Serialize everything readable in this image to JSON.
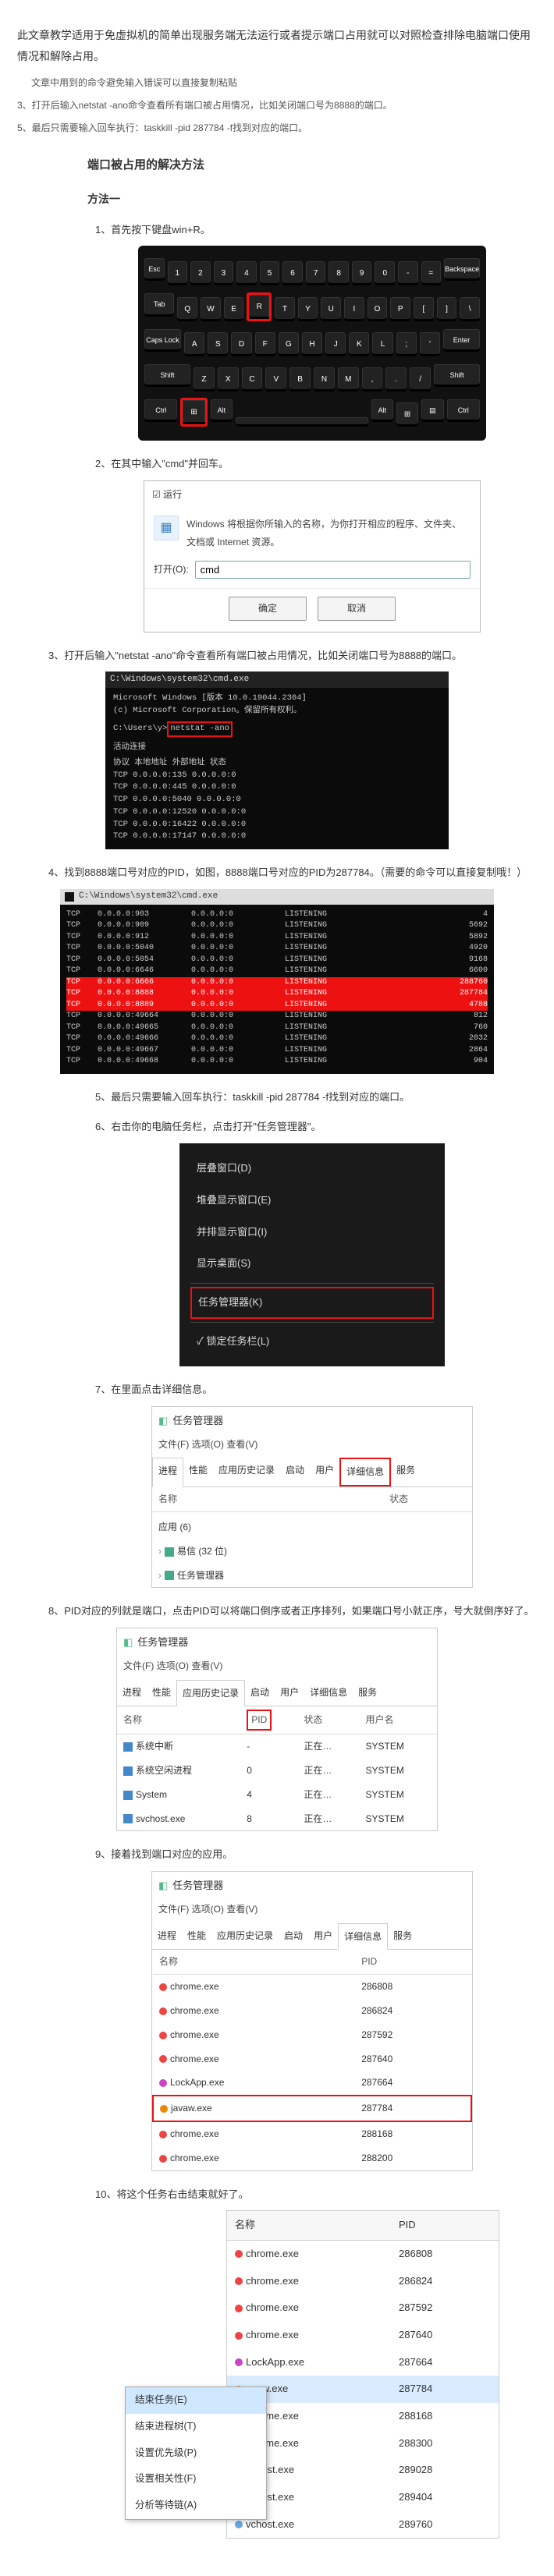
{
  "header": {
    "intro": "此文章教学适用于免虚拟机的简单出现服务端无法运行或者提示端口占用就可以对照检查排除电脑端口使用情况和解除占用。",
    "note": "文章中用到的命令避免输入错误可以直接复制粘贴",
    "line3": "3、打开后输入netstat -ano命令查看所有端口被占用情况，比如关闭端口号为8888的端口。",
    "line5": "5、最后只需要输入回车执行：taskkill -pid 287784 -f找到对应的端口。"
  },
  "titles": {
    "section": "端口被占用的解决方法",
    "method1": "方法一"
  },
  "steps": {
    "s1": "1、首先按下键盘win+R。",
    "s2": "2、在其中输入\"cmd\"并回车。",
    "s3": "3、打开后输入\"netstat -ano\"命令查看所有端口被占用情况，比如关闭端口号为8888的端口。",
    "s4": "4、找到8888端口号对应的PID，如图，8888端口号对应的PID为287784。（需要的命令可以直接复制哦！）",
    "s5": "5、最后只需要输入回车执行：taskkill -pid 287784 -f找到对应的端口。",
    "s6": "6、右击你的电脑任务栏，点击打开\"任务管理器\"。",
    "s7": "7、在里面点击详细信息。",
    "s8": "8、PID对应的列就是端口，点击PID可以将端口倒序或者正序排列，如果端口号小就正序，号大就倒序好了。",
    "s9": "9、接着找到端口对应的应用。",
    "s10": "10、将这个任务右击结束就好了。"
  },
  "run": {
    "title": "☑ 运行",
    "icon": "▦",
    "desc": "Windows 将根据你所输入的名称，为你打开相应的程序、文件夹、文档或 Internet 资源。",
    "label": "打开(O):",
    "value": "cmd",
    "ok": "确定",
    "cancel": "取消"
  },
  "cmd1": {
    "title": "C:\\Windows\\system32\\cmd.exe",
    "line1": "Microsoft Windows [版本 10.0.19044.2304]",
    "line2": "(c) Microsoft Corporation。保留所有权利。",
    "line3": "C:\\Users\\y>",
    "cmd": "netstat -ano",
    "hdr_active": "活动连接",
    "hdr": " 协议  本地地址            外部地址          状态",
    "rows": [
      "  TCP    0.0.0.0:135          0.0.0.0:0",
      "  TCP    0.0.0.0:445          0.0.0.0:0",
      "  TCP    0.0.0.0:5040         0.0.0.0:0",
      "  TCP    0.0.0.0:12520        0.0.0.0:0",
      "  TCP    0.0.0.0:16422        0.0.0.0:0",
      "  TCP    0.0.0.0:17147        0.0.0.0:0"
    ]
  },
  "net": {
    "title": "C:\\Windows\\system32\\cmd.exe",
    "rows": [
      {
        "p": "TCP",
        "l": "0.0.0.0:903",
        "r": "0.0.0.0:0",
        "s": "LISTENING",
        "pid": "4"
      },
      {
        "p": "TCP",
        "l": "0.0.0.0:909",
        "r": "0.0.0.0:0",
        "s": "LISTENING",
        "pid": "5692"
      },
      {
        "p": "TCP",
        "l": "0.0.0.0:912",
        "r": "0.0.0.0:0",
        "s": "LISTENING",
        "pid": "5892"
      },
      {
        "p": "TCP",
        "l": "0.0.0.0:5040",
        "r": "0.0.0.0:0",
        "s": "LISTENING",
        "pid": "4920"
      },
      {
        "p": "TCP",
        "l": "0.0.0.0:5054",
        "r": "0.0.0.0:0",
        "s": "LISTENING",
        "pid": "9168"
      },
      {
        "p": "TCP",
        "l": "0.0.0.0:6646",
        "r": "0.0.0.0:0",
        "s": "LISTENING",
        "pid": "6600"
      },
      {
        "p": "TCP",
        "l": "0.0.0.0:6666",
        "r": "0.0.0.0:0",
        "s": "LISTENING",
        "pid": "288760",
        "hi": true
      },
      {
        "p": "TCP",
        "l": "0.0.0.0:8888",
        "r": "0.0.0.0:0",
        "s": "LISTENING",
        "pid": "287784",
        "hi": true
      },
      {
        "p": "TCP",
        "l": "0.0.0.0:8889",
        "r": "0.0.0.0:0",
        "s": "LISTENING",
        "pid": "4788",
        "hi": true
      },
      {
        "p": "TCP",
        "l": "0.0.0.0:49664",
        "r": "0.0.0.0:0",
        "s": "LISTENING",
        "pid": "812"
      },
      {
        "p": "TCP",
        "l": "0.0.0.0:49665",
        "r": "0.0.0.0:0",
        "s": "LISTENING",
        "pid": "760"
      },
      {
        "p": "TCP",
        "l": "0.0.0.0:49666",
        "r": "0.0.0.0:0",
        "s": "LISTENING",
        "pid": "2032"
      },
      {
        "p": "TCP",
        "l": "0.0.0.0:49667",
        "r": "0.0.0.0:0",
        "s": "LISTENING",
        "pid": "2864"
      },
      {
        "p": "TCP",
        "l": "0.0.0.0:49668",
        "r": "0.0.0.0:0",
        "s": "LISTENING",
        "pid": "904"
      }
    ]
  },
  "ctx1": {
    "items": [
      "层叠窗口(D)",
      "堆叠显示窗口(E)",
      "并排显示窗口(I)",
      "显示桌面(S)"
    ],
    "hi": "任务管理器(K)",
    "last": "✓ 锁定任务栏(L)"
  },
  "tm1": {
    "win": "任务管理器",
    "menu": "文件(F)  选项(O)  查看(V)",
    "tabs": [
      "进程",
      "性能",
      "应用历史记录",
      "启动",
      "用户",
      "详细信息",
      "服务"
    ],
    "cols": {
      "name": "名称",
      "status": "状态"
    },
    "apps_label": "应用 (6)",
    "rows": [
      {
        "name": "易信 (32 位)"
      },
      {
        "name": "任务管理器"
      }
    ]
  },
  "tm2": {
    "win": "任务管理器",
    "menu": "文件(F)  选项(O)  查看(V)",
    "tabs": [
      "进程",
      "性能",
      "应用历史记录",
      "启动",
      "用户",
      "详细信息",
      "服务"
    ],
    "cols": {
      "name": "名称",
      "pid": "PID",
      "status": "状态",
      "user": "用户名"
    },
    "rows": [
      {
        "name": "系统中断",
        "pid": "-",
        "status": "正在…",
        "user": "SYSTEM"
      },
      {
        "name": "系统空闲进程",
        "pid": "0",
        "status": "正在…",
        "user": "SYSTEM"
      },
      {
        "name": "System",
        "pid": "4",
        "status": "正在…",
        "user": "SYSTEM"
      },
      {
        "name": "svchost.exe",
        "pid": "8",
        "status": "正在…",
        "user": "SYSTEM"
      }
    ]
  },
  "tm3": {
    "win": "任务管理器",
    "menu": "文件(F)  选项(O)  查看(V)",
    "tabs": [
      "进程",
      "性能",
      "应用历史记录",
      "启动",
      "用户",
      "详细信息",
      "服务"
    ],
    "cols": {
      "name": "名称",
      "pid": "PID"
    },
    "rows": [
      {
        "name": "chrome.exe",
        "pid": "286808"
      },
      {
        "name": "chrome.exe",
        "pid": "286824"
      },
      {
        "name": "chrome.exe",
        "pid": "287592"
      },
      {
        "name": "chrome.exe",
        "pid": "287640"
      },
      {
        "name": "LockApp.exe",
        "pid": "287664"
      },
      {
        "name": "javaw.exe",
        "pid": "287784",
        "hi": true
      },
      {
        "name": "chrome.exe",
        "pid": "288168"
      },
      {
        "name": "chrome.exe",
        "pid": "288200"
      }
    ]
  },
  "ctx2": {
    "cols": {
      "name": "名称",
      "pid": "PID"
    },
    "rows": [
      {
        "name": "chrome.exe",
        "pid": "286808"
      },
      {
        "name": "chrome.exe",
        "pid": "286824"
      },
      {
        "name": "chrome.exe",
        "pid": "287592"
      },
      {
        "name": "chrome.exe",
        "pid": "287640"
      },
      {
        "name": "LockApp.exe",
        "pid": "287664"
      },
      {
        "name": "avaw.exe",
        "pid": "287784",
        "sel": true
      },
      {
        "name": "chrome.exe",
        "pid": "288168"
      },
      {
        "name": "chrome.exe",
        "pid": "288300"
      },
      {
        "name": "vchost.exe",
        "pid": "289028"
      },
      {
        "name": "vchost.exe",
        "pid": "289404"
      },
      {
        "name": "vchost.exe",
        "pid": "289760"
      }
    ],
    "menu": [
      {
        "label": "结束任务(E)",
        "sel": true
      },
      {
        "label": "结束进程树(T)"
      },
      {
        "label": "设置优先级(P)"
      },
      {
        "label": "设置相关性(F)"
      },
      {
        "label": "分析等待链(A)"
      }
    ]
  }
}
